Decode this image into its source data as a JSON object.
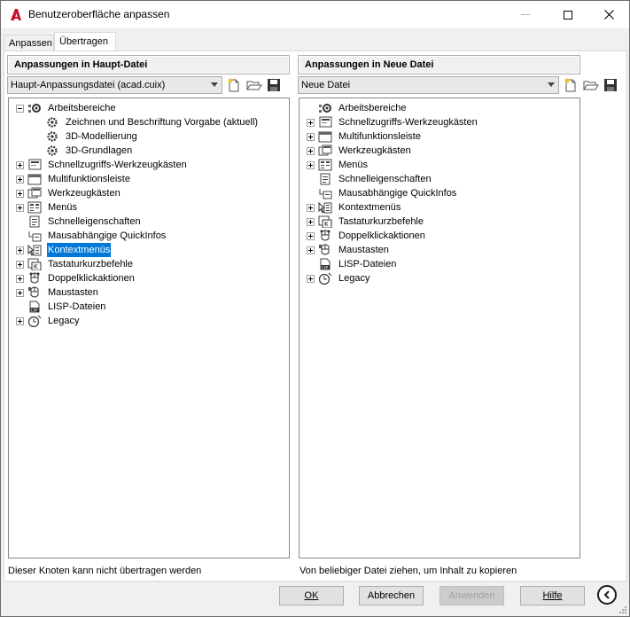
{
  "window": {
    "title": "Benutzeroberfläche anpassen"
  },
  "tabs": [
    {
      "label": "Anpassen"
    },
    {
      "label": "Übertragen"
    }
  ],
  "left": {
    "header": "Anpassungen in Haupt-Datei",
    "combo_value": "Haupt-Anpassungsdatei (acad.cuix)",
    "status": "Dieser Knoten kann nicht übertragen werden",
    "nodes": [
      {
        "label": "Arbeitsbereiche",
        "icon": "gear-stack-icon"
      },
      {
        "label": "Zeichnen und Beschriftung Vorgabe (aktuell)",
        "icon": "gear-icon"
      },
      {
        "label": "3D-Modellierung",
        "icon": "gear-icon"
      },
      {
        "label": "3D-Grundlagen",
        "icon": "gear-icon"
      },
      {
        "label": "Schnellzugriffs-Werkzeugkästen",
        "icon": "toolbar-stack-icon"
      },
      {
        "label": "Multifunktionsleiste",
        "icon": "ribbon-icon"
      },
      {
        "label": "Werkzeugkästen",
        "icon": "toolbars-icon"
      },
      {
        "label": "Menüs",
        "icon": "menu-icon"
      },
      {
        "label": "Schnelleigenschaften",
        "icon": "quick-properties-icon"
      },
      {
        "label": "Mausabhängige QuickInfos",
        "icon": "rollover-tooltip-icon"
      },
      {
        "label": "Kontextmenüs",
        "icon": "shortcut-menu-icon"
      },
      {
        "label": "Tastaturkurzbefehle",
        "icon": "keyboard-shortcut-icon"
      },
      {
        "label": "Doppelklickaktionen",
        "icon": "double-click-icon"
      },
      {
        "label": "Maustasten",
        "icon": "mouse-icon"
      },
      {
        "label": "LISP-Dateien",
        "icon": "lisp-file-icon"
      },
      {
        "label": "Legacy",
        "icon": "legacy-clock-icon"
      }
    ]
  },
  "right": {
    "header": "Anpassungen in Neue Datei",
    "combo_value": "Neue Datei",
    "status": "Von beliebiger Datei ziehen, um Inhalt zu kopieren",
    "nodes": [
      {
        "label": "Arbeitsbereiche",
        "icon": "gear-stack-icon"
      },
      {
        "label": "Schnellzugriffs-Werkzeugkästen",
        "icon": "toolbar-stack-icon"
      },
      {
        "label": "Multifunktionsleiste",
        "icon": "ribbon-icon"
      },
      {
        "label": "Werkzeugkästen",
        "icon": "toolbars-icon"
      },
      {
        "label": "Menüs",
        "icon": "menu-icon"
      },
      {
        "label": "Schnelleigenschaften",
        "icon": "quick-properties-icon"
      },
      {
        "label": "Mausabhängige QuickInfos",
        "icon": "rollover-tooltip-icon"
      },
      {
        "label": "Kontextmenüs",
        "icon": "shortcut-menu-icon"
      },
      {
        "label": "Tastaturkurzbefehle",
        "icon": "keyboard-shortcut-icon"
      },
      {
        "label": "Doppelklickaktionen",
        "icon": "double-click-icon"
      },
      {
        "label": "Maustasten",
        "icon": "mouse-icon"
      },
      {
        "label": "LISP-Dateien",
        "icon": "lisp-file-icon"
      },
      {
        "label": "Legacy",
        "icon": "legacy-clock-icon"
      }
    ]
  },
  "buttons": {
    "ok": "OK",
    "abbrechen": "Abbrechen",
    "anwenden": "Anwenden",
    "hilfe": "Hilfe"
  },
  "colors": {
    "selection": "#0078d7",
    "app_icon": "#c8102e"
  }
}
